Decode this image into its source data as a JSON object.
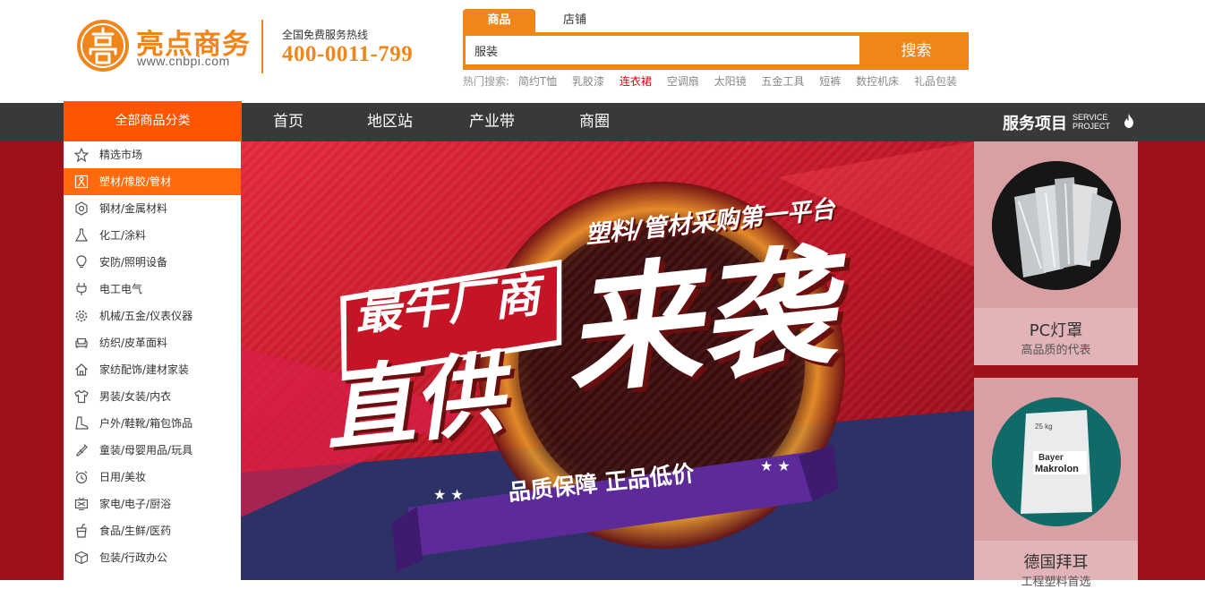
{
  "brand": {
    "name": "亮点商务",
    "url": "www.cnbpi.com",
    "color": "#f08519"
  },
  "hotline": {
    "label": "全国免费服务热线",
    "number": "400-0011-799"
  },
  "search": {
    "tabs": [
      "商品",
      "店铺"
    ],
    "active_tab": "商品",
    "value": "服装",
    "button": "搜索",
    "hot_label": "热门搜索:",
    "hot_terms": [
      "简约T恤",
      "乳胶漆",
      "连衣裙",
      "空调扇",
      "太阳镜",
      "五金工具",
      "短裤",
      "数控机床",
      "礼品包装"
    ],
    "highlight_term": "连衣裙"
  },
  "nav": {
    "all_categories": "全部商品分类",
    "links": [
      "首页",
      "地区站",
      "产业带",
      "商圈"
    ],
    "service_title": "服务项目",
    "service_en_1": "SERVICE",
    "service_en_2": "PROJECT"
  },
  "categories": [
    {
      "label": "精选市场",
      "icon": "star-icon"
    },
    {
      "label": "塑材/橡胶/管材",
      "icon": "person-icon",
      "active": true
    },
    {
      "label": "钢材/金属材料",
      "icon": "hexagon-nut-icon"
    },
    {
      "label": "化工/涂料",
      "icon": "flask-icon"
    },
    {
      "label": "安防/照明设备",
      "icon": "bulb-icon"
    },
    {
      "label": "电工电气",
      "icon": "plug-icon"
    },
    {
      "label": "机械/五金/仪表仪器",
      "icon": "gear-icon"
    },
    {
      "label": "纺织/皮革面料",
      "icon": "sofa-icon"
    },
    {
      "label": "家纺配饰/建材家装",
      "icon": "home-icon"
    },
    {
      "label": "男装/女装/内衣",
      "icon": "shirt-icon"
    },
    {
      "label": "户外/鞋靴/箱包饰品",
      "icon": "boot-icon"
    },
    {
      "label": "童装/母婴用品/玩具",
      "icon": "bottle-icon"
    },
    {
      "label": "日用/美妆",
      "icon": "clock-icon"
    },
    {
      "label": "家电/电子/厨浴",
      "icon": "tv-icon"
    },
    {
      "label": "食品/生鲜/医药",
      "icon": "drink-icon"
    },
    {
      "label": "包装/行政办公",
      "icon": "box-icon"
    }
  ],
  "banner": {
    "tagline": "塑料/管材采购第一平台",
    "headline_1": "最牛厂商",
    "headline_2": "直供",
    "headline_3": "来袭",
    "ribbon": "品质保障 正品低价",
    "bg_color": "#c8182a"
  },
  "promos": [
    {
      "title": "PC灯罩",
      "subtitle": "高品质的代表"
    },
    {
      "title": "德国拜耳",
      "subtitle": "工程塑料首选",
      "bag_brand": "Bayer",
      "bag_product": "Makrolon",
      "bag_weight": "25 kg"
    }
  ]
}
